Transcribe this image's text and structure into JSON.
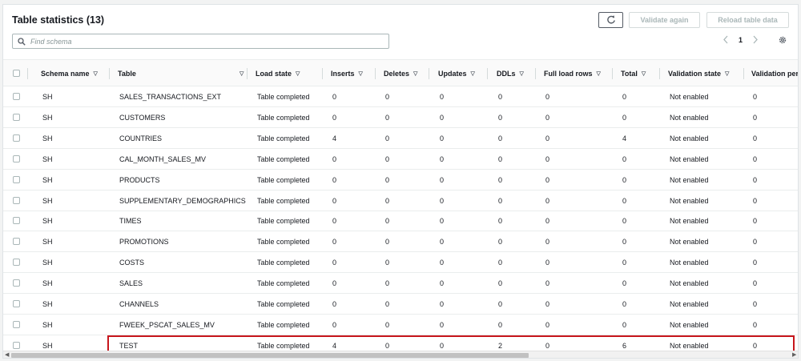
{
  "header": {
    "title": "Table statistics (13)",
    "validate_label": "Validate again",
    "reload_label": "Reload table data"
  },
  "search": {
    "placeholder": "Find schema"
  },
  "pagination": {
    "current_page": "1"
  },
  "columns": [
    "Schema name",
    "Table",
    "Load state",
    "Inserts",
    "Deletes",
    "Updates",
    "DDLs",
    "Full load rows",
    "Total",
    "Validation state",
    "Validation per"
  ],
  "rows": [
    [
      "SH",
      "SALES_TRANSACTIONS_EXT",
      "Table completed",
      "0",
      "0",
      "0",
      "0",
      "0",
      "0",
      "Not enabled",
      "0"
    ],
    [
      "SH",
      "CUSTOMERS",
      "Table completed",
      "0",
      "0",
      "0",
      "0",
      "0",
      "0",
      "Not enabled",
      "0"
    ],
    [
      "SH",
      "COUNTRIES",
      "Table completed",
      "4",
      "0",
      "0",
      "0",
      "0",
      "4",
      "Not enabled",
      "0"
    ],
    [
      "SH",
      "CAL_MONTH_SALES_MV",
      "Table completed",
      "0",
      "0",
      "0",
      "0",
      "0",
      "0",
      "Not enabled",
      "0"
    ],
    [
      "SH",
      "PRODUCTS",
      "Table completed",
      "0",
      "0",
      "0",
      "0",
      "0",
      "0",
      "Not enabled",
      "0"
    ],
    [
      "SH",
      "SUPPLEMENTARY_DEMOGRAPHICS",
      "Table completed",
      "0",
      "0",
      "0",
      "0",
      "0",
      "0",
      "Not enabled",
      "0"
    ],
    [
      "SH",
      "TIMES",
      "Table completed",
      "0",
      "0",
      "0",
      "0",
      "0",
      "0",
      "Not enabled",
      "0"
    ],
    [
      "SH",
      "PROMOTIONS",
      "Table completed",
      "0",
      "0",
      "0",
      "0",
      "0",
      "0",
      "Not enabled",
      "0"
    ],
    [
      "SH",
      "COSTS",
      "Table completed",
      "0",
      "0",
      "0",
      "0",
      "0",
      "0",
      "Not enabled",
      "0"
    ],
    [
      "SH",
      "SALES",
      "Table completed",
      "0",
      "0",
      "0",
      "0",
      "0",
      "0",
      "Not enabled",
      "0"
    ],
    [
      "SH",
      "CHANNELS",
      "Table completed",
      "0",
      "0",
      "0",
      "0",
      "0",
      "0",
      "Not enabled",
      "0"
    ],
    [
      "SH",
      "FWEEK_PSCAT_SALES_MV",
      "Table completed",
      "0",
      "0",
      "0",
      "0",
      "0",
      "0",
      "Not enabled",
      "0"
    ],
    [
      "SH",
      "TEST",
      "Table completed",
      "4",
      "0",
      "0",
      "2",
      "0",
      "6",
      "Not enabled",
      "0"
    ]
  ],
  "highlighted_row": "TEST",
  "colors": {
    "highlight": "#c7161c",
    "text": "#16191f"
  },
  "icons": [
    "refresh-icon",
    "search-icon",
    "chevron-left-icon",
    "chevron-right-icon",
    "settings-icon",
    "sort-icon"
  ]
}
